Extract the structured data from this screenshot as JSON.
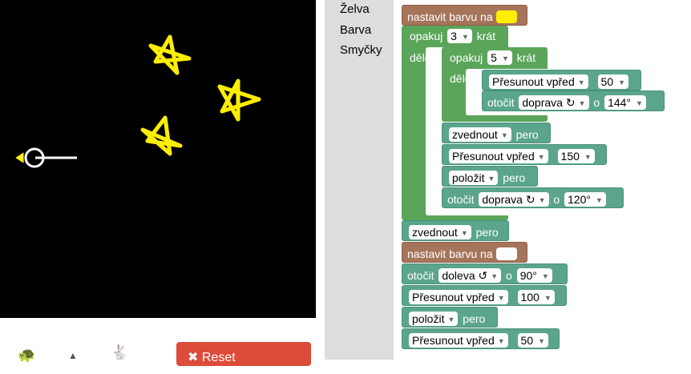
{
  "categories": [
    "Želva",
    "Barva",
    "Smyčky"
  ],
  "colors": {
    "yellow": "#ffee00",
    "white": "#ffffff",
    "canvas_bg": "#000000",
    "reset_bg": "#dd4b39"
  },
  "reset_label": "Reset",
  "blocks": {
    "set_color_1": {
      "label": "nastavit barvu na",
      "color": "#ffee00"
    },
    "repeat_outer": {
      "label": "opakuj",
      "times": "3",
      "krat": "krát",
      "do": "dělej"
    },
    "repeat_inner": {
      "label": "opakuj",
      "times": "5",
      "krat": "krát",
      "do": "dělej"
    },
    "move_1": {
      "label": "Přesunout vpřed",
      "value": "50"
    },
    "turn_1": {
      "label": "otočit",
      "dir": "doprava ↻",
      "o": "o",
      "angle": "144°"
    },
    "penup_1": {
      "label": "zvednout",
      "pero": "pero"
    },
    "move_2": {
      "label": "Přesunout vpřed",
      "value": "150"
    },
    "pendown_1": {
      "label": "položit",
      "pero": "pero"
    },
    "turn_2": {
      "label": "otočit",
      "dir": "doprava ↻",
      "o": "o",
      "angle": "120°"
    },
    "penup_2": {
      "label": "zvednout",
      "pero": "pero"
    },
    "set_color_2": {
      "label": "nastavit barvu na",
      "color": "#ffffff"
    },
    "turn_3": {
      "label": "otočit",
      "dir": "doleva ↺",
      "o": "o",
      "angle": "90°"
    },
    "move_3": {
      "label": "Přesunout vpřed",
      "value": "100"
    },
    "pendown_2": {
      "label": "položit",
      "pero": "pero"
    },
    "move_4": {
      "label": "Přesunout vpřed",
      "value": "50"
    }
  }
}
